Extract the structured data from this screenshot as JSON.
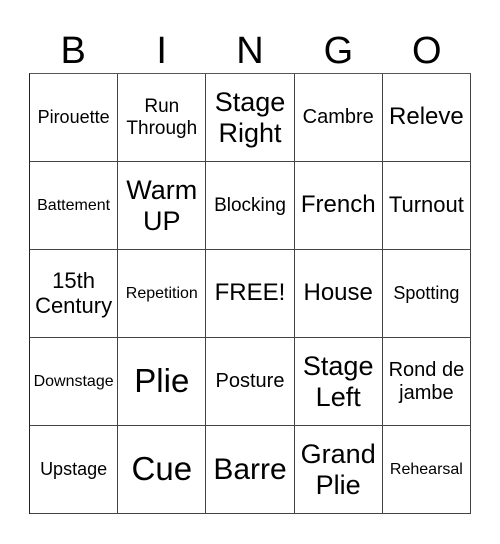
{
  "header": [
    "B",
    "I",
    "N",
    "G",
    "O"
  ],
  "cells": [
    [
      "Pirouette",
      "Run Through",
      "Stage Right",
      "Cambre",
      "Releve"
    ],
    [
      "Battement",
      "Warm UP",
      "Blocking",
      "French",
      "Turnout"
    ],
    [
      "15th Century",
      "Repetition",
      "FREE!",
      "House",
      "Spotting"
    ],
    [
      "Downstage",
      "Plie",
      "Posture",
      "Stage Left",
      "Rond de jambe"
    ],
    [
      "Upstage",
      "Cue",
      "Barre",
      "Grand Plie",
      "Rehearsal"
    ]
  ]
}
